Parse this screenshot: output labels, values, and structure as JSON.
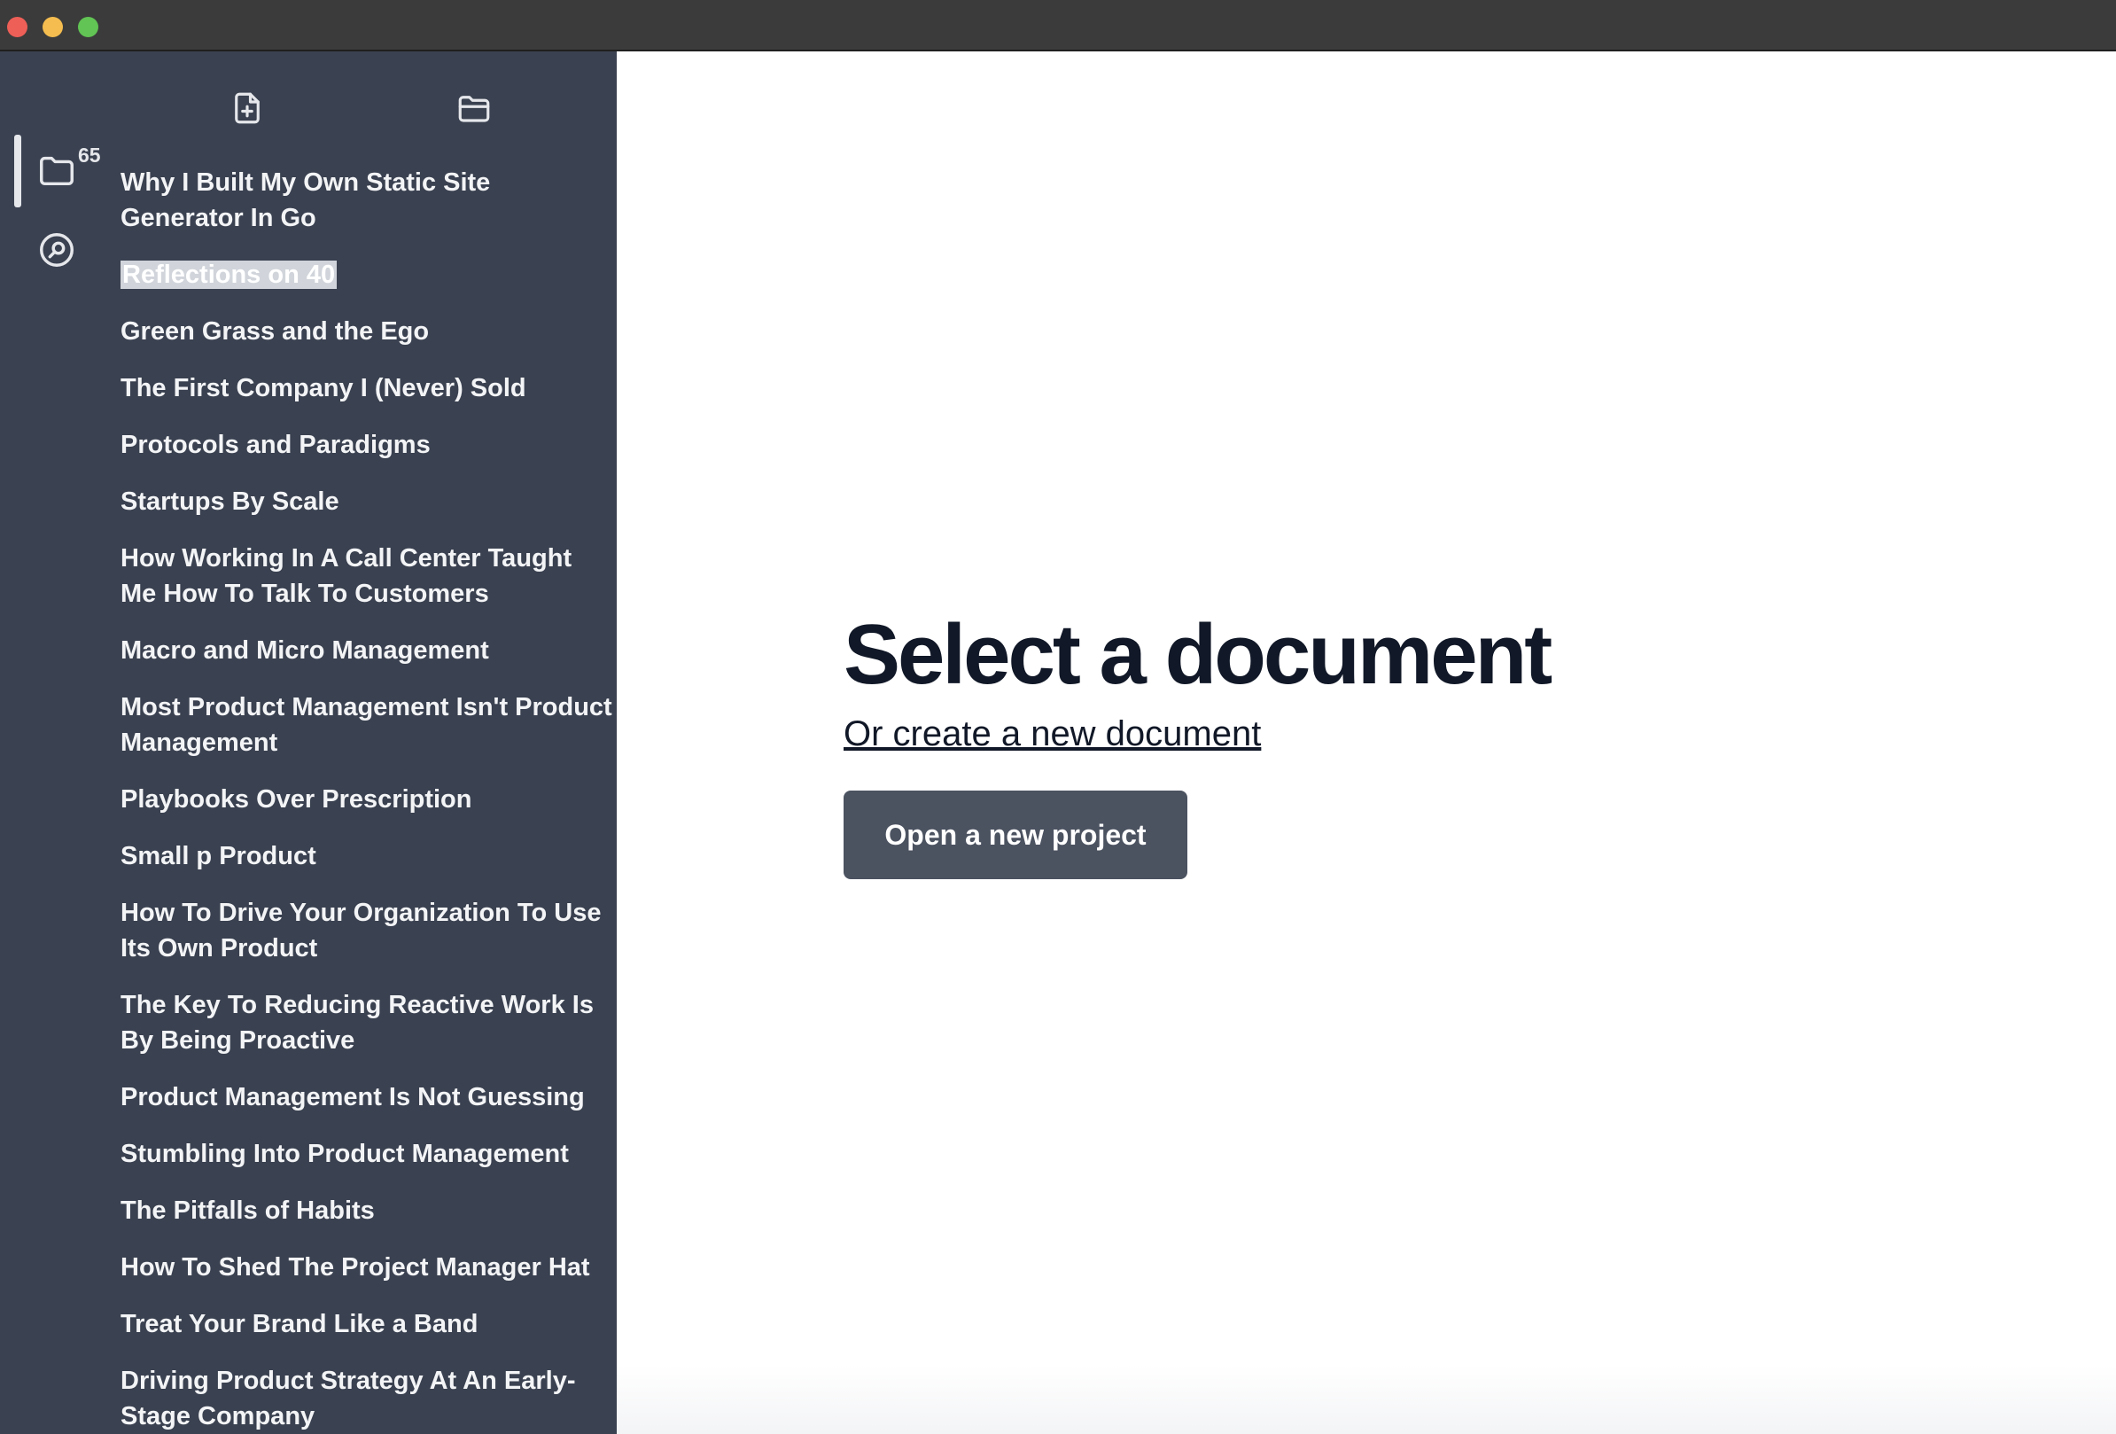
{
  "sidebar": {
    "toolbar": {
      "new_document_icon": "file-plus-icon",
      "open_folder_icon": "folder-open-icon"
    },
    "rail": {
      "documents_icon": "folder-icon",
      "documents_count": "65",
      "search_icon": "search-icon"
    },
    "documents": [
      {
        "title": "Why I Built My Own Static Site Generator In Go"
      },
      {
        "title": "Reflections on 40",
        "selected": true
      },
      {
        "title": "Green Grass and the Ego"
      },
      {
        "title": "The First Company I (Never) Sold"
      },
      {
        "title": "Protocols and Paradigms"
      },
      {
        "title": "Startups By Scale"
      },
      {
        "title": "How Working In A Call Center Taught Me How To Talk To Customers"
      },
      {
        "title": "Macro and Micro Management"
      },
      {
        "title": "Most Product Management Isn't Product Management"
      },
      {
        "title": "Playbooks Over Prescription"
      },
      {
        "title": "Small p Product"
      },
      {
        "title": "How To Drive Your Organization To Use Its Own Product"
      },
      {
        "title": "The Key To Reducing Reactive Work Is By Being Proactive"
      },
      {
        "title": "Product Management Is Not Guessing"
      },
      {
        "title": "Stumbling Into Product Management"
      },
      {
        "title": "The Pitfalls of Habits"
      },
      {
        "title": "How To Shed The Project Manager Hat"
      },
      {
        "title": "Treat Your Brand Like a Band"
      },
      {
        "title": "Driving Product Strategy At An Early-Stage Company"
      }
    ]
  },
  "main": {
    "heading": "Select a document",
    "create_link": "Or create a new document",
    "open_project_button": "Open a new project"
  },
  "colors": {
    "sidebar_bg": "#3a4150",
    "titlebar_bg": "#3b3b3b",
    "button_bg": "#4b5260",
    "heading_text": "#111827"
  }
}
